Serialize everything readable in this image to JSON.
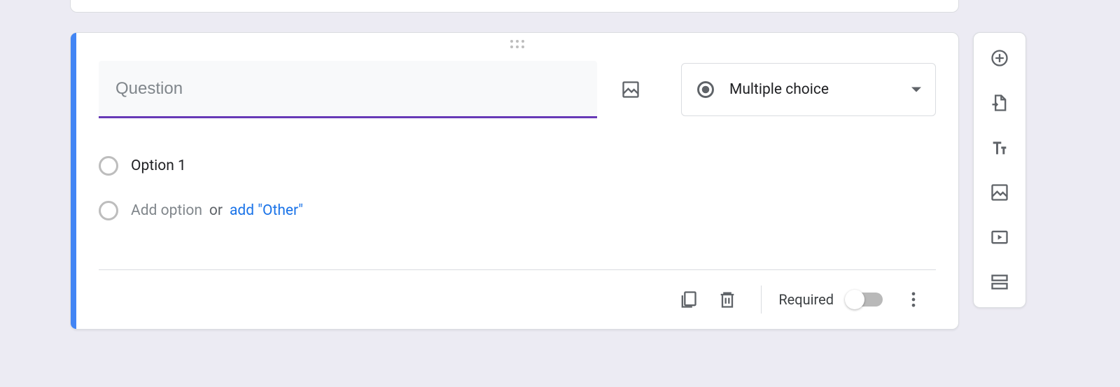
{
  "question": {
    "placeholder": "Question",
    "value": "",
    "type_label": "Multiple choice"
  },
  "options": {
    "option1": "Option 1",
    "add_option": "Add option",
    "or": "or",
    "add_other": "add \"Other\""
  },
  "footer": {
    "required_label": "Required",
    "required_value": false
  },
  "toolbar": {
    "add_question": "Add question",
    "import_questions": "Import questions",
    "add_title": "Add title and description",
    "add_image": "Add image",
    "add_video": "Add video",
    "add_section": "Add section"
  }
}
